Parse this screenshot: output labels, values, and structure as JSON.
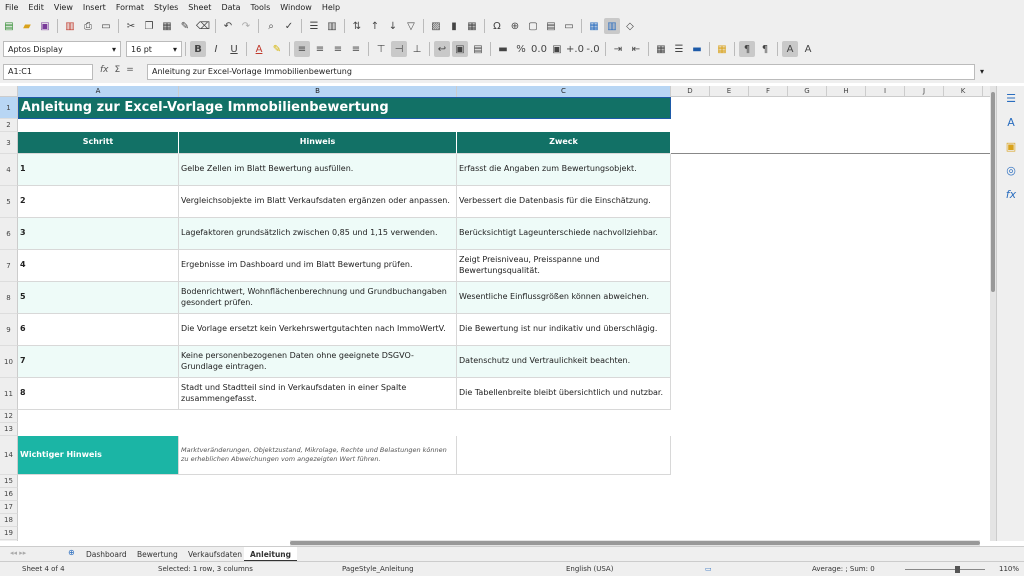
{
  "menu": [
    "File",
    "Edit",
    "View",
    "Insert",
    "Format",
    "Styles",
    "Sheet",
    "Data",
    "Tools",
    "Window",
    "Help"
  ],
  "toolbar2": {
    "font": "Aptos Display",
    "size": "16 pt"
  },
  "formula": {
    "namebox": "A1:C1",
    "content": "Anleitung zur Excel-Vorlage Immobilienbewertung"
  },
  "columns": [
    "A",
    "B",
    "C",
    "D",
    "E",
    "F",
    "G",
    "H",
    "I",
    "J",
    "K"
  ],
  "sheet": {
    "title": "Anleitung zur Excel-Vorlage Immobilienbewertung",
    "headers": [
      "Schritt",
      "Hinweis",
      "Zweck"
    ],
    "rows": [
      {
        "n": "1",
        "hint": "Gelbe Zellen im Blatt Bewertung ausfüllen.",
        "purpose": "Erfasst die Angaben zum Bewertungsobjekt."
      },
      {
        "n": "2",
        "hint": "Vergleichsobjekte im Blatt Verkaufsdaten ergänzen oder anpassen.",
        "purpose": "Verbessert die Datenbasis für die Einschätzung."
      },
      {
        "n": "3",
        "hint": "Lagefaktoren grundsätzlich zwischen 0,85 und 1,15 verwenden.",
        "purpose": "Berücksichtigt Lageunterschiede nachvollziehbar."
      },
      {
        "n": "4",
        "hint": "Ergebnisse im Dashboard und im Blatt Bewertung prüfen.",
        "purpose": "Zeigt Preisniveau, Preisspanne und Bewertungsqualität."
      },
      {
        "n": "5",
        "hint": "Bodenrichtwert, Wohnflächenberechnung und Grundbuchangaben gesondert prüfen.",
        "purpose": "Wesentliche Einflussgrößen können abweichen."
      },
      {
        "n": "6",
        "hint": "Die Vorlage ersetzt kein Verkehrswertgutachten nach ImmoWertV.",
        "purpose": "Die Bewertung ist nur indikativ und überschlägig."
      },
      {
        "n": "7",
        "hint": "Keine personenbezogenen Daten ohne geeignete DSGVO-Grundlage eintragen.",
        "purpose": "Datenschutz und Vertraulichkeit beachten."
      },
      {
        "n": "8",
        "hint": "Stadt und Stadtteil sind in Verkaufsdaten in einer Spalte zusammengefasst.",
        "purpose": "Die Tabellenbreite bleibt übersichtlich und nutzbar."
      }
    ],
    "warning_label": "Wichtiger Hinweis",
    "warning_text": "Marktveränderungen, Objektzustand, Mikrolage, Rechte und Belastungen können zu erheblichen Abweichungen vom angezeigten Wert führen."
  },
  "tabs": [
    "Dashboard",
    "Bewertung",
    "Verkaufsdaten",
    "Anleitung"
  ],
  "status": {
    "sheet": "Sheet 4 of 4",
    "selection": "Selected: 1 row, 3 columns",
    "pagestyle": "PageStyle_Anleitung",
    "language": "English (USA)",
    "sum": "Average: ; Sum: 0",
    "zoom": "110%"
  },
  "colors": {
    "header": "#127166",
    "accent": "#1bb5a5",
    "tint": "#eefbf8"
  }
}
